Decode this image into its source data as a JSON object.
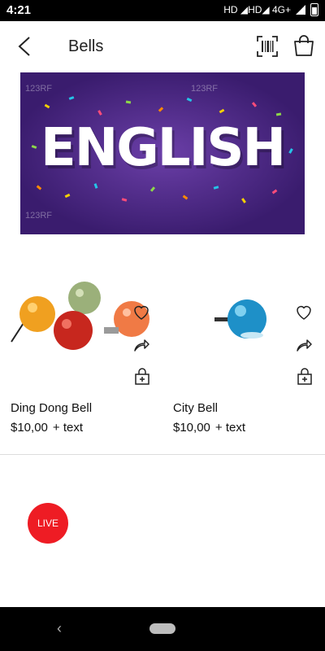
{
  "status_bar": {
    "time": "4:21",
    "network_labels": "HD ◢HD◢ 4G+"
  },
  "header": {
    "title": "Bells"
  },
  "banner": {
    "text": "ENGLISH",
    "watermarks": [
      "123RF",
      "123RF",
      "123RF"
    ]
  },
  "products": [
    {
      "name": "Ding Dong Bell",
      "price": "$10,00",
      "extra": "+ text"
    },
    {
      "name": "City Bell",
      "price": "$10,00",
      "extra": "+ text"
    }
  ],
  "live": {
    "label": "LIVE"
  },
  "colors": {
    "live_red": "#ee1c24",
    "banner_purple": "#4a2585",
    "divider": "#dddddd"
  },
  "icons": [
    "back-arrow-icon",
    "barcode-icon",
    "shopping-bag-icon",
    "heart-icon",
    "share-icon",
    "cart-add-icon"
  ]
}
